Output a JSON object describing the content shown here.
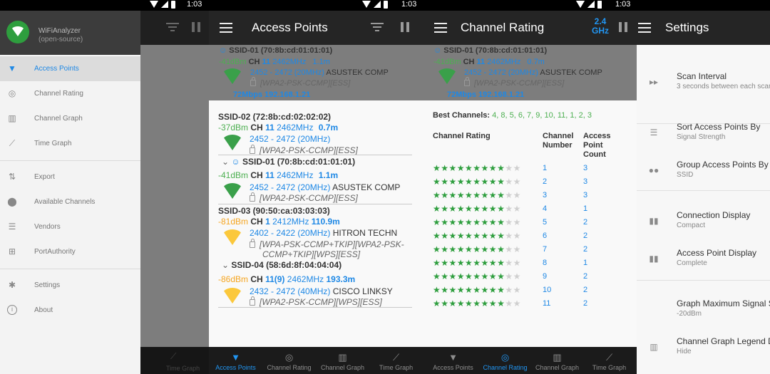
{
  "status": {
    "time": "1:03"
  },
  "drawer": {
    "app_name": "WiFiAnalyzer",
    "app_sub": "(open-source)",
    "items": [
      {
        "label": "Access Points",
        "icon": "wifi-icon"
      },
      {
        "label": "Channel Rating",
        "icon": "channel-rating-icon"
      },
      {
        "label": "Channel Graph",
        "icon": "bar-chart-icon"
      },
      {
        "label": "Time Graph",
        "icon": "line-chart-icon"
      },
      {
        "label": "Export",
        "icon": "export-icon"
      },
      {
        "label": "Available Channels",
        "icon": "location-pin-icon"
      },
      {
        "label": "Vendors",
        "icon": "list-icon"
      },
      {
        "label": "PortAuthority",
        "icon": "network-icon"
      },
      {
        "label": "Settings",
        "icon": "gear-icon"
      },
      {
        "label": "About",
        "icon": "info-icon"
      }
    ],
    "bg_nav_label": "Time Graph"
  },
  "ap_screen": {
    "title": "Access Points",
    "connected": {
      "ssid": "SSID-01 (70:8b:cd:01:01:01)",
      "dbm": "-41dBm",
      "ch": "CH",
      "chnum": "11",
      "freq": "2462MHz",
      "dist": "1.1m",
      "range": "2452 - 2472 (20MHz)",
      "vendor": "ASUSTEK COMP",
      "sec": "[WPA2-PSK-CCMP][ESS]",
      "speed": "72Mbps 192.168.1.21"
    },
    "list": [
      {
        "ssid": "SSID-02 (72:8b:cd:02:02:02)",
        "dbm": "-37dBm",
        "chnum": "11",
        "freq": "2462MHz",
        "dist": "0.7m",
        "range": "2452 - 2472 (20MHz)",
        "vendor": "",
        "sec": "[WPA2-PSK-CCMP][ESS]"
      },
      {
        "ssid": "SSID-01 (70:8b:cd:01:01:01)",
        "dbm": "-41dBm",
        "chnum": "11",
        "freq": "2462MHz",
        "dist": "1.1m",
        "range": "2452 - 2472 (20MHz)",
        "vendor": "ASUSTEK COMP",
        "sec": "[WPA2-PSK-CCMP][ESS]"
      },
      {
        "ssid": "SSID-03 (90:50:ca:03:03:03)",
        "dbm": "-81dBm",
        "chnum": "1",
        "freq": "2412MHz",
        "dist": "110.9m",
        "range": "2402 - 2422 (20MHz)",
        "vendor": "HITRON TECHN",
        "sec1": "[WPA-PSK-CCMP+TKIP][WPA2-PSK-",
        "sec2": "CCMP+TKIP][WPS][ESS]"
      },
      {
        "ssid": "SSID-04 (58:6d:8f:04:04:04)",
        "dbm": "-86dBm",
        "chnum": "11(9)",
        "freq": "2462MHz",
        "dist": "193.3m",
        "range": "2432 - 2472 (40MHz)",
        "vendor": "CISCO LINKSY",
        "sec": "[WPA2-PSK-CCMP][WPS][ESS]"
      }
    ],
    "ch_label": "CH"
  },
  "cr_screen": {
    "title": "Channel Rating",
    "band_top": "2.4",
    "band_bottom": "GHz",
    "best_label": "Best Channels:",
    "best_values": "4, 8, 5, 6, 7, 9, 10, 11, 1, 2, 3",
    "col_rating": "Channel Rating",
    "col_channel_1": "Channel",
    "col_channel_2": "Number",
    "col_count_1": "Access",
    "col_count_2": "Point",
    "col_count_3": "Count",
    "rows": [
      {
        "stars": 9,
        "channel": "1",
        "count": "3"
      },
      {
        "stars": 9,
        "channel": "2",
        "count": "3"
      },
      {
        "stars": 9,
        "channel": "3",
        "count": "3"
      },
      {
        "stars": 9,
        "channel": "4",
        "count": "1"
      },
      {
        "stars": 9,
        "channel": "5",
        "count": "2"
      },
      {
        "stars": 9,
        "channel": "6",
        "count": "2"
      },
      {
        "stars": 9,
        "channel": "7",
        "count": "2"
      },
      {
        "stars": 9,
        "channel": "8",
        "count": "1"
      },
      {
        "stars": 9,
        "channel": "9",
        "count": "2"
      },
      {
        "stars": 9,
        "channel": "10",
        "count": "2"
      },
      {
        "stars": 9,
        "channel": "11",
        "count": "2"
      }
    ],
    "total_stars": 11
  },
  "settings_screen": {
    "title": "Settings",
    "items": [
      {
        "title": "Scan Interval",
        "sub": "3 seconds between each scan",
        "icon": "fast-forward-icon"
      },
      {
        "title": "Sort Access Points By",
        "sub": "Signal Strength",
        "icon": "sort-icon"
      },
      {
        "title": "Group Access Points By",
        "sub": "SSID",
        "icon": "group-icon"
      },
      {
        "title": "Connection Display",
        "sub": "Compact",
        "icon": "view-icon"
      },
      {
        "title": "Access Point Display",
        "sub": "Complete",
        "icon": "view-icon"
      },
      {
        "title": "Graph Maximum Signal S",
        "sub": "-20dBm",
        "icon": ""
      },
      {
        "title": "Channel Graph Legend D",
        "sub": "Hide",
        "icon": "legend-icon"
      }
    ]
  },
  "nav": [
    "Access Points",
    "Channel Rating",
    "Channel Graph",
    "Time Graph"
  ],
  "colors": {
    "accent": "#2196f3",
    "green": "#4caf50",
    "appbar": "#252525"
  }
}
